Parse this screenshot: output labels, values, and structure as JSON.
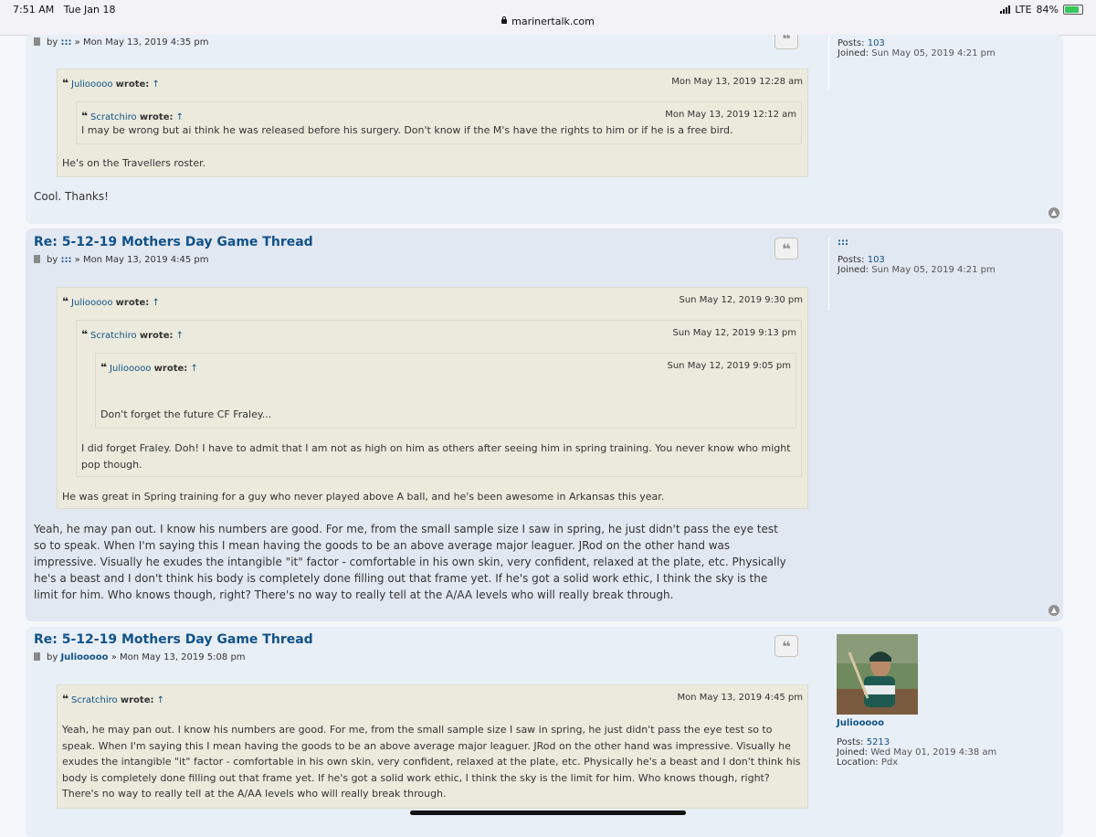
{
  "status_bar": {
    "time": "7:51 AM",
    "date": "Tue Jan 18",
    "url": "marinertalk.com",
    "network": "LTE",
    "battery": "84%",
    "battery_level": 0.84
  },
  "post1": {
    "meta_by": "by",
    "meta_user": ":::",
    "meta_date": "» Mon May 13, 2019 4:35 pm",
    "profile": {
      "posts_label": "Posts:",
      "posts": "103",
      "joined_label": "Joined:",
      "joined": "Sun May 05, 2019 4:21 pm"
    },
    "quote": {
      "author": "Juliooooo",
      "wrote": "wrote:",
      "arrow": "↑",
      "date": "Mon May 13, 2019 12:28 am",
      "inner": {
        "author": "Scratchiro",
        "wrote": "wrote:",
        "arrow": "↑",
        "date": "Mon May 13, 2019 12:12 am",
        "text": "I may be wrong but ai think he was released before his surgery. Don't know if the M's have the rights to him or if he is a free bird."
      },
      "text": "He's on the Travellers roster."
    },
    "text": "Cool. Thanks!"
  },
  "post2": {
    "title": "Re: 5-12-19 Mothers Day Game Thread",
    "meta_by": "by",
    "meta_user": ":::",
    "meta_date": "» Mon May 13, 2019 4:45 pm",
    "profile": {
      "username": ":::",
      "posts_label": "Posts:",
      "posts": "103",
      "joined_label": "Joined:",
      "joined": "Sun May 05, 2019 4:21 pm"
    },
    "quote": {
      "author": "Juliooooo",
      "wrote": "wrote:",
      "arrow": "↑",
      "date": "Sun May 12, 2019 9:30 pm",
      "inner": {
        "author": "Scratchiro",
        "wrote": "wrote:",
        "arrow": "↑",
        "date": "Sun May 12, 2019 9:13 pm",
        "inner": {
          "author": "Juliooooo",
          "wrote": "wrote:",
          "arrow": "↑",
          "date": "Sun May 12, 2019 9:05 pm",
          "text": "Don't forget the future CF Fraley..."
        },
        "text": "I did forget Fraley. Doh! I have to admit that I am not as high on him as others after seeing him in spring training. You never know who might pop though."
      },
      "text": "He was great in Spring training for a guy who never played above A ball, and he's been awesome in Arkansas this year."
    },
    "text": "Yeah, he may pan out. I know his numbers are good. For me, from the small sample size I saw in spring, he just didn't pass the eye test so to speak. When I'm saying this I mean having the goods to be an above average major leaguer. JRod on the other hand was impressive. Visually he exudes the intangible \"it\" factor - comfortable in his own skin, very confident, relaxed at the plate, etc. Physically he's a beast and I don't think his body is completely done filling out that frame yet. If he's got a solid work ethic, I think the sky is the limit for him. Who knows though, right? There's no way to really tell at the A/AA levels who will really break through."
  },
  "post3": {
    "title": "Re: 5-12-19 Mothers Day Game Thread",
    "meta_by": "by",
    "meta_user": "Juliooooo",
    "meta_date": "» Mon May 13, 2019 5:08 pm",
    "profile": {
      "username": "Juliooooo",
      "posts_label": "Posts:",
      "posts": "5213",
      "joined_label": "Joined:",
      "joined": "Wed May 01, 2019 4:38 am",
      "location_label": "Location:",
      "location": "Pdx"
    },
    "quote": {
      "author": "Scratchiro",
      "wrote": "wrote:",
      "arrow": "↑",
      "date": "Mon May 13, 2019 4:45 pm",
      "text": "Yeah, he may pan out. I know his numbers are good. For me, from the small sample size I saw in spring, he just didn't pass the eye test so to speak. When I'm saying this I mean having the goods to be an above average major leaguer. JRod on the other hand was impressive. Visually he exudes the intangible \"it\" factor - comfortable in his own skin, very confident, relaxed at the plate, etc. Physically he's a beast and I don't think his body is completely done filling out that frame yet. If he's got a solid work ethic, I think the sky is the limit for him. Who knows though, right? There's no way to really tell at the A/AA levels who will really break through."
    }
  }
}
